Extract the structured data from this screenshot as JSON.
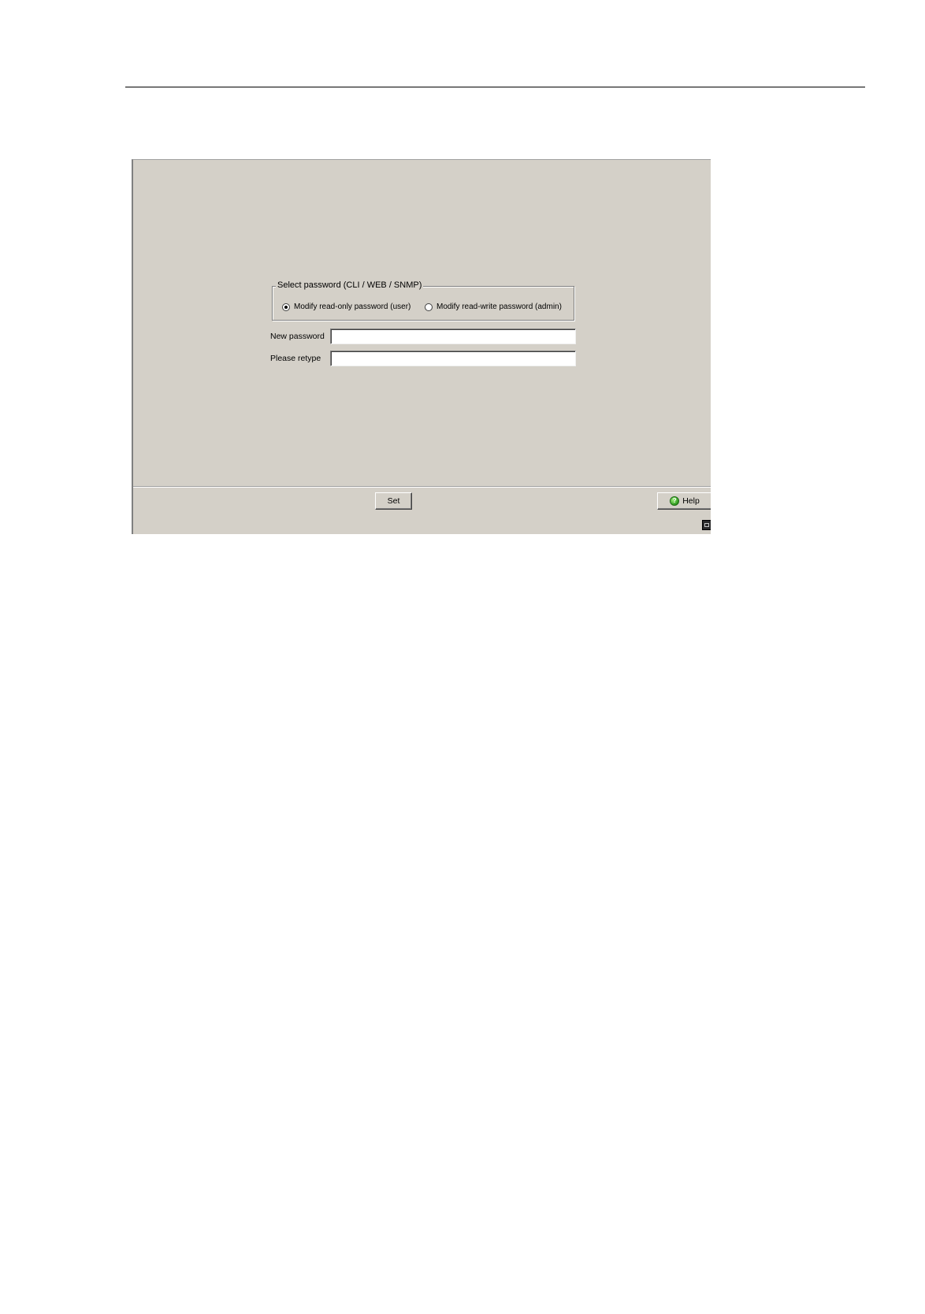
{
  "password_dialog": {
    "group_title": "Select password  (CLI / WEB / SNMP)",
    "options": [
      {
        "label": "Modify read-only password (user)",
        "selected": true
      },
      {
        "label": "Modify read-write password (admin)",
        "selected": false
      }
    ],
    "new_password_label": "New password",
    "new_password_value": "",
    "retype_label": "Please retype",
    "retype_value": ""
  },
  "buttons": {
    "set_label": "Set",
    "help_label": "Help"
  },
  "icons": {
    "help": "help-icon",
    "status": "status-icon"
  },
  "colors": {
    "panel_background": "#d4d0c8",
    "help_icon": "#2e9a1e"
  }
}
